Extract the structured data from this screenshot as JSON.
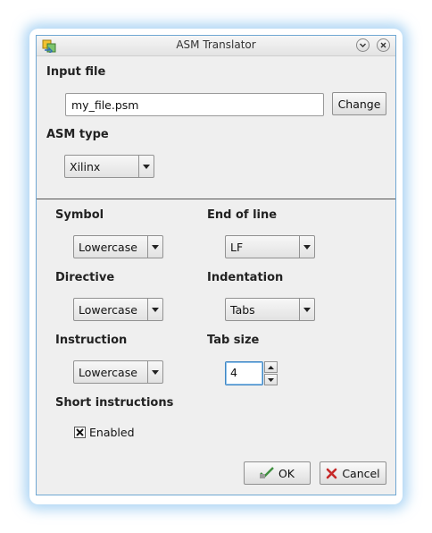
{
  "window": {
    "title": "ASM Translator",
    "app_icon": "translator-app-icon",
    "minimize_icon": "chevron-down-icon",
    "close_icon": "close-icon"
  },
  "input_file": {
    "heading": "Input file",
    "value": "my_file.psm",
    "change_label": "Change"
  },
  "asm_type": {
    "heading": "ASM type",
    "selected": "Xilinx"
  },
  "symbol": {
    "heading": "Symbol",
    "selected": "Lowercase"
  },
  "end_of_line": {
    "heading": "End of line",
    "selected": "LF"
  },
  "directive": {
    "heading": "Directive",
    "selected": "Lowercase"
  },
  "indentation": {
    "heading": "Indentation",
    "selected": "Tabs"
  },
  "instruction": {
    "heading": "Instruction",
    "selected": "Lowercase"
  },
  "tab_size": {
    "heading": "Tab size",
    "value": "4"
  },
  "short_instructions": {
    "heading": "Short instructions",
    "checkbox_label": "Enabled",
    "checked": true
  },
  "buttons": {
    "ok_label": "OK",
    "ok_icon": "ok-check-icon",
    "cancel_label": "Cancel",
    "cancel_icon": "cancel-x-icon"
  },
  "colors": {
    "window_bg": "#efefef",
    "focus_border": "#3f86c4",
    "glow": "#6eb4eb",
    "cancel_red": "#c62828",
    "ok_green": "#3f8f3f"
  }
}
